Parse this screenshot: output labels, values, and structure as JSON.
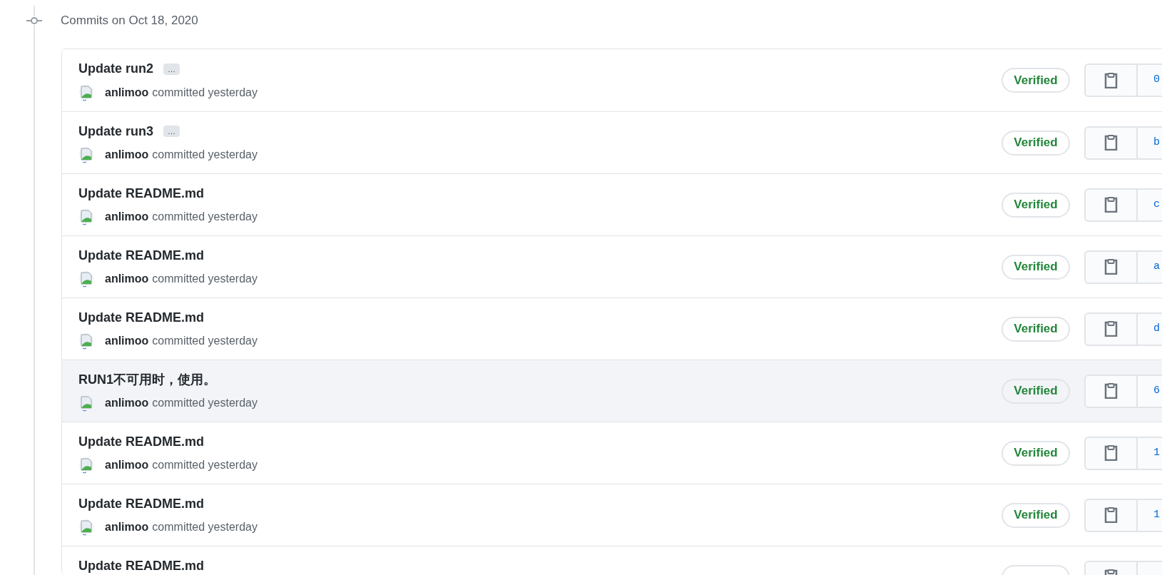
{
  "heading": "Commits on Oct 18, 2020",
  "commits": [
    {
      "title": "Update run2",
      "ellipsis": "…",
      "author": "anlimoo",
      "meta": "committed yesterday",
      "badge": "Verified",
      "hash": "0",
      "highlighted": false
    },
    {
      "title": "Update run3",
      "ellipsis": "…",
      "author": "anlimoo",
      "meta": "committed yesterday",
      "badge": "Verified",
      "hash": "b",
      "highlighted": false
    },
    {
      "title": "Update README.md",
      "author": "anlimoo",
      "meta": "committed yesterday",
      "badge": "Verified",
      "hash": "c",
      "highlighted": false
    },
    {
      "title": "Update README.md",
      "author": "anlimoo",
      "meta": "committed yesterday",
      "badge": "Verified",
      "hash": "a",
      "highlighted": false
    },
    {
      "title": "Update README.md",
      "author": "anlimoo",
      "meta": "committed yesterday",
      "badge": "Verified",
      "hash": "d",
      "highlighted": false
    },
    {
      "title": "RUN1不可用时，使用。",
      "author": "anlimoo",
      "meta": "committed yesterday",
      "badge": "Verified",
      "hash": "6",
      "highlighted": true
    },
    {
      "title": "Update README.md",
      "author": "anlimoo",
      "meta": "committed yesterday",
      "badge": "Verified",
      "hash": "1",
      "highlighted": false
    },
    {
      "title": "Update README.md",
      "author": "anlimoo",
      "meta": "committed yesterday",
      "badge": "Verified",
      "hash": "1",
      "highlighted": false
    },
    {
      "title": "Update README.md",
      "highlighted": false
    }
  ]
}
